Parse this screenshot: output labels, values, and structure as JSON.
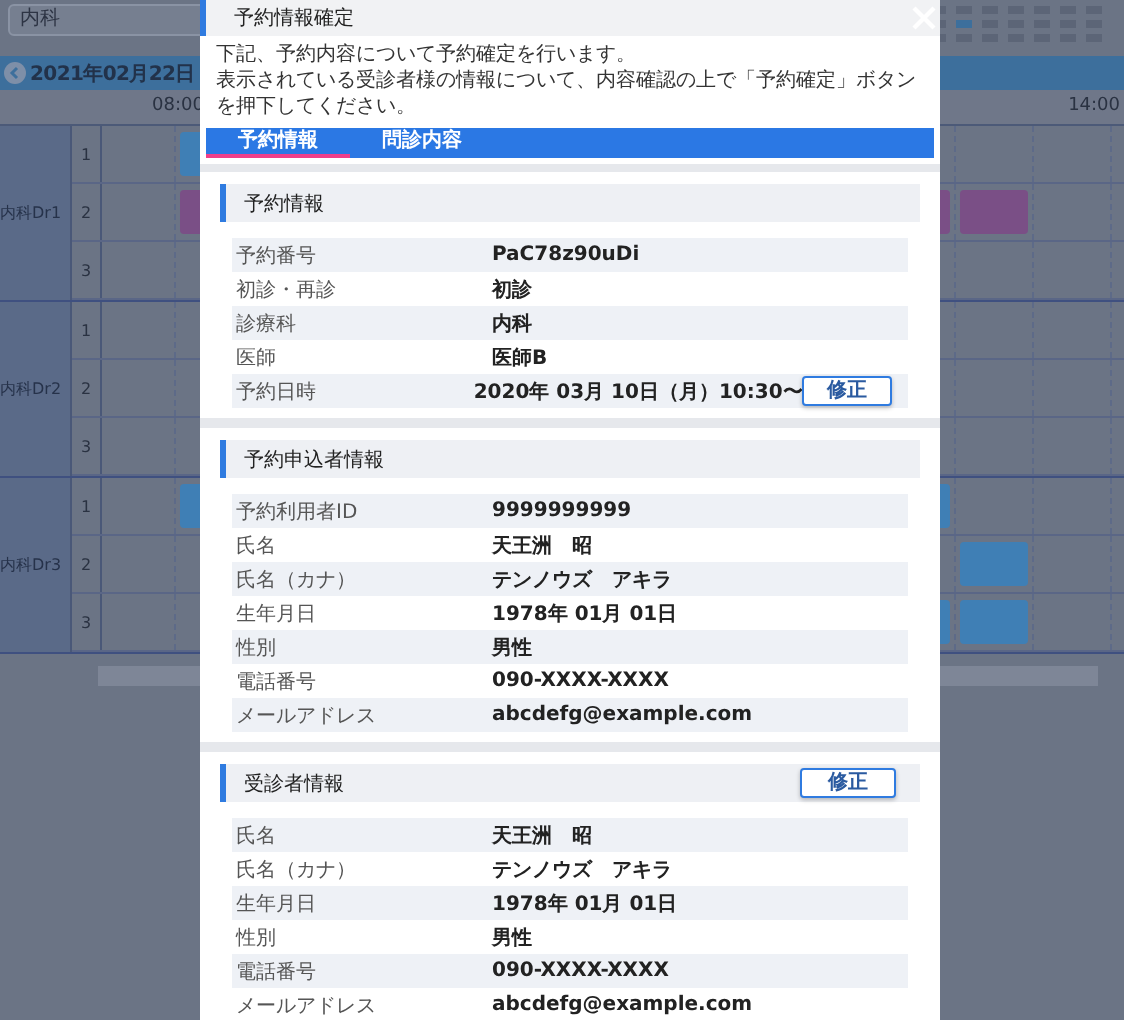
{
  "background": {
    "filter": "内科",
    "date": "2021年02月22日",
    "times": [
      "08:00",
      "14:00"
    ],
    "doctors": [
      {
        "name": "内科Dr1",
        "slots": [
          {
            "number": "1",
            "cells": [
              null,
              {
                "color": "#3f7fb5"
              },
              null,
              null,
              null,
              null,
              null,
              null,
              null,
              null,
              null,
              null,
              null
            ]
          },
          {
            "number": "2",
            "cells": [
              null,
              {
                "color": "#7a4f86"
              },
              null,
              null,
              null,
              null,
              null,
              null,
              null,
              null,
              {
                "color": "#7a4f86"
              },
              {
                "color": "#7a4f86"
              },
              null
            ]
          },
          {
            "number": "3",
            "cells": [
              null,
              null,
              null,
              null,
              null,
              null,
              null,
              null,
              null,
              null,
              null,
              null,
              null
            ]
          }
        ]
      },
      {
        "name": "内科Dr2",
        "slots": [
          {
            "number": "1",
            "cells": [
              null,
              null,
              null,
              null,
              null,
              null,
              null,
              null,
              null,
              null,
              null,
              null,
              null
            ]
          },
          {
            "number": "2",
            "cells": [
              null,
              null,
              null,
              null,
              null,
              null,
              null,
              null,
              null,
              null,
              null,
              null,
              null
            ]
          },
          {
            "number": "3",
            "cells": [
              null,
              null,
              null,
              null,
              null,
              null,
              null,
              null,
              null,
              null,
              null,
              null,
              null
            ]
          }
        ]
      },
      {
        "name": "内科Dr3",
        "slots": [
          {
            "number": "1",
            "cells": [
              null,
              {
                "color": "#3f7fb5"
              },
              null,
              null,
              null,
              null,
              null,
              null,
              null,
              null,
              {
                "color": "#3f7fb5"
              },
              null,
              null
            ]
          },
          {
            "number": "2",
            "cells": [
              null,
              null,
              null,
              null,
              null,
              null,
              null,
              null,
              null,
              null,
              null,
              {
                "color": "#3f7fb5"
              },
              null
            ]
          },
          {
            "number": "3",
            "cells": [
              null,
              null,
              null,
              null,
              null,
              null,
              null,
              null,
              null,
              null,
              {
                "color": "#3f7fb5"
              },
              {
                "color": "#3f7fb5"
              },
              null
            ]
          }
        ]
      }
    ]
  },
  "dialog": {
    "title": "予約情報確定",
    "description": [
      "下記、予約内容について予約確定を行います。",
      "表示されている受診者様の情報について、内容確認の上で「予約確定」ボタンを押下してください。"
    ],
    "tabs": [
      {
        "label": "予約情報",
        "selected": true
      },
      {
        "label": "問診内容",
        "selected": false
      }
    ],
    "sections": [
      {
        "title": "予約情報",
        "rows": [
          {
            "label": "予約番号",
            "value": "PaC78z90uDi"
          },
          {
            "label": "初診・再診",
            "value": "初診"
          },
          {
            "label": "診療科",
            "value": "内科"
          },
          {
            "label": "医師",
            "value": "医師B"
          },
          {
            "label": "予約日時",
            "value": "2020年 03月 10日（月）10:30〜",
            "button": "修正"
          }
        ]
      },
      {
        "title": "予約申込者情報",
        "rows": [
          {
            "label": "予約利用者ID",
            "value": "9999999999"
          },
          {
            "label": "氏名",
            "value": "天王洲　昭"
          },
          {
            "label": "氏名（カナ）",
            "value": "テンノウズ　アキラ"
          },
          {
            "label": "生年月日",
            "value": "1978年 01月 01日"
          },
          {
            "label": "性別",
            "value": "男性"
          },
          {
            "label": "電話番号",
            "value": "090-XXXX-XXXX"
          },
          {
            "label": "メールアドレス",
            "value": "abcdefg@example.com"
          }
        ]
      },
      {
        "title": "受診者情報",
        "button": "修正",
        "rows": [
          {
            "label": "氏名",
            "value": "天王洲　昭"
          },
          {
            "label": "氏名（カナ）",
            "value": "テンノウズ　アキラ"
          },
          {
            "label": "生年月日",
            "value": "1978年 01月 01日"
          },
          {
            "label": "性別",
            "value": "男性"
          },
          {
            "label": "電話番号",
            "value": "090-XXXX-XXXX"
          },
          {
            "label": "メールアドレス",
            "value": "abcdefg@example.com"
          }
        ]
      }
    ]
  }
}
